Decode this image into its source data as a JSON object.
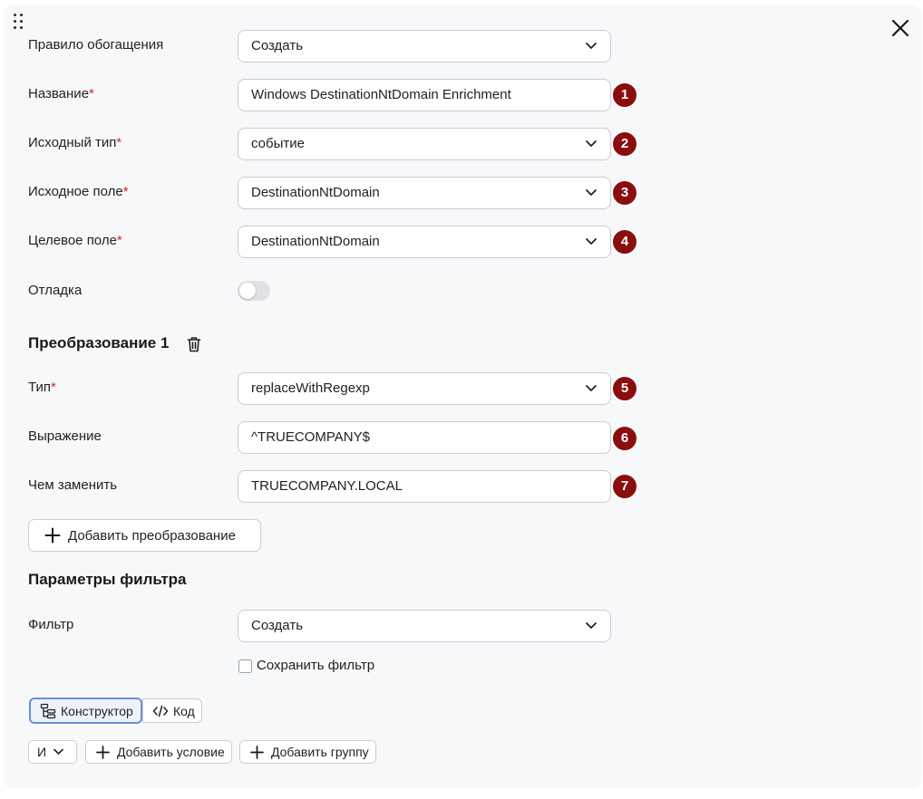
{
  "form": {
    "enrichment_rule": {
      "label": "Правило обогащения",
      "value": "Создать"
    },
    "name": {
      "label": "Название",
      "required_mark": "*",
      "value": "Windows DestinationNtDomain Enrichment",
      "badge": "1"
    },
    "source_type": {
      "label": "Исходный тип",
      "required_mark": "*",
      "value": "событие",
      "badge": "2"
    },
    "source_field": {
      "label": "Исходное поле",
      "required_mark": "*",
      "value": "DestinationNtDomain",
      "badge": "3"
    },
    "target_field": {
      "label": "Целевое поле",
      "required_mark": "*",
      "value": "DestinationNtDomain",
      "badge": "4"
    },
    "debug": {
      "label": "Отладка",
      "enabled": false
    }
  },
  "transformation": {
    "title": "Преобразование 1",
    "type": {
      "label": "Тип",
      "required_mark": "*",
      "value": "replaceWithRegexp",
      "badge": "5"
    },
    "expression": {
      "label": "Выражение",
      "value": "^TRUECOMPANY$",
      "badge": "6"
    },
    "replace_with": {
      "label": "Чем заменить",
      "value": "TRUECOMPANY.LOCAL",
      "badge": "7"
    },
    "add_button": "Добавить преобразование"
  },
  "filter": {
    "title": "Параметры фильтра",
    "filter_field": {
      "label": "Фильтр",
      "value": "Создать"
    },
    "save_filter": {
      "label": "Сохранить фильтр",
      "checked": false
    },
    "modes": {
      "constructor": "Конструктор",
      "code": "Код",
      "active": "constructor"
    },
    "operator": "И",
    "add_condition": "Добавить условие",
    "add_group": "Добавить группу"
  },
  "colors": {
    "badge": "#8b0e0e",
    "required": "#d42b2b",
    "active_tab_border": "#6a8fd8",
    "panel_background": "#f7f8fa"
  },
  "icons": {
    "drag": "drag-handle-icon",
    "close": "close-icon",
    "chevron": "chevron-down-icon",
    "trash": "trash-icon",
    "plus": "plus-icon",
    "constructor": "tree-structure-icon",
    "code": "code-brackets-icon"
  }
}
